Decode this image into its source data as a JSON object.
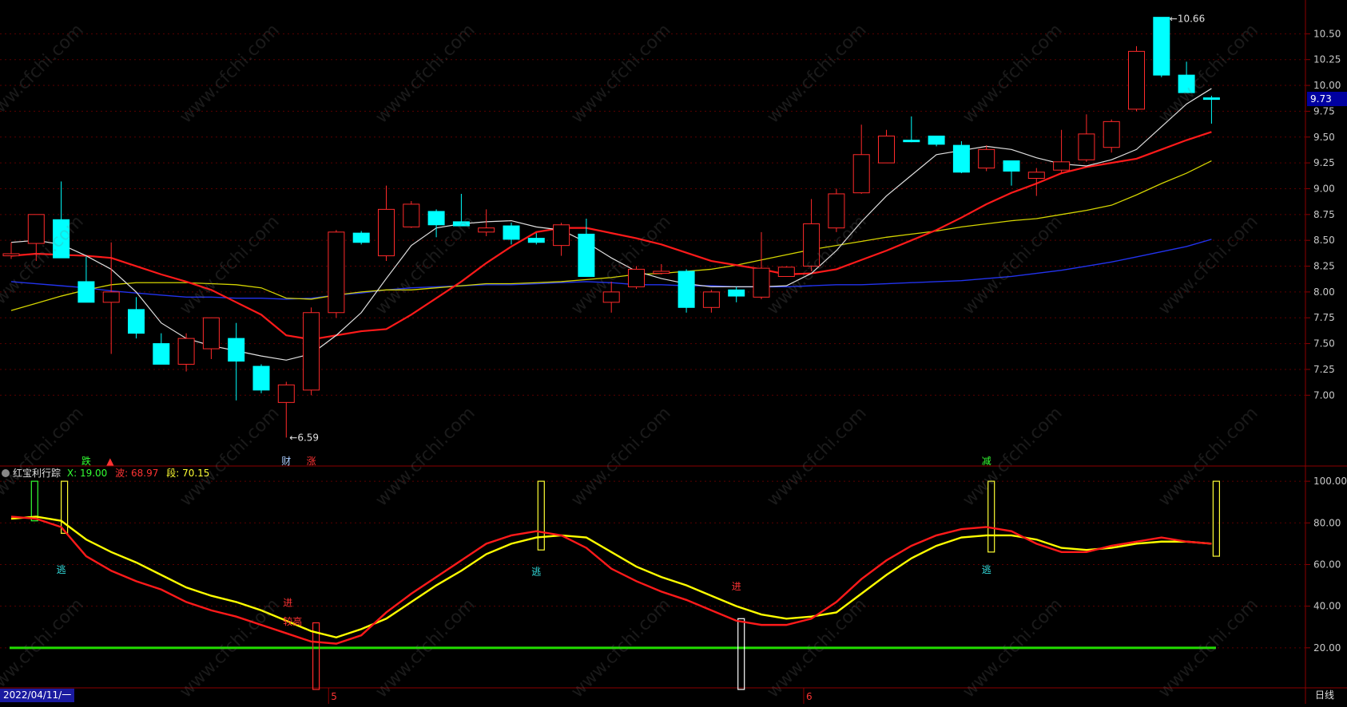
{
  "colors": {
    "up": "#ff2a2a",
    "down": "#00ffff",
    "ma5": "#e0e0e0",
    "ma10": "#ff1a1a",
    "ma20": "#d4d400",
    "ma60": "#2233ee",
    "k_line": "#ff1a1a",
    "d_line": "#ffff00",
    "base_line": "#22dd00",
    "frame": "#8b0000"
  },
  "price_axis": {
    "min": 6.5,
    "max": 10.75,
    "ticks": [
      "10.50",
      "10.25",
      "10.00",
      "9.75",
      "9.50",
      "9.25",
      "9.00",
      "8.75",
      "8.50",
      "8.25",
      "8.00",
      "7.75",
      "7.50",
      "7.25",
      "7.00"
    ]
  },
  "ind_axis": {
    "min": 0,
    "max": 110,
    "ticks": [
      "100.00",
      "80.00",
      "60.00",
      "40.00",
      "20.00"
    ]
  },
  "last_price_tag": "9.73",
  "high_label": "10.66",
  "low_label": "6.59",
  "indicator": {
    "name": "红宝利行踪",
    "x_label": "X:",
    "x_value": "19.00",
    "bo_label": "波:",
    "bo_value": "68.97",
    "duan_label": "段:",
    "duan_value": "70.15"
  },
  "event_labels": [
    {
      "text": "跌",
      "color": "#33ff33"
    },
    {
      "text": "▲",
      "color": "#ff3333"
    },
    {
      "text": "财",
      "color": "#aaccff"
    },
    {
      "text": "涨",
      "color": "#ff3333"
    },
    {
      "text": "减",
      "color": "#33ff33"
    }
  ],
  "signal_labels": [
    "逃",
    "进",
    "较高",
    "逃",
    "进",
    "逃"
  ],
  "date_start": "2022/04/11/一",
  "month_ticks": [
    "5",
    "6"
  ],
  "period_label": "日线",
  "watermark": "www.cfchi.com",
  "chart_data": {
    "type": "candlestick",
    "candles": [
      {
        "o": 8.35,
        "h": 8.48,
        "l": 8.32,
        "c": 8.37
      },
      {
        "o": 8.47,
        "h": 8.75,
        "l": 8.3,
        "c": 8.75
      },
      {
        "o": 8.7,
        "h": 9.07,
        "l": 8.33,
        "c": 8.33
      },
      {
        "o": 8.1,
        "h": 8.34,
        "l": 7.9,
        "c": 7.9
      },
      {
        "o": 7.9,
        "h": 8.48,
        "l": 7.4,
        "c": 8.0
      },
      {
        "o": 7.83,
        "h": 7.95,
        "l": 7.55,
        "c": 7.6
      },
      {
        "o": 7.5,
        "h": 7.6,
        "l": 7.3,
        "c": 7.3
      },
      {
        "o": 7.3,
        "h": 7.6,
        "l": 7.23,
        "c": 7.55
      },
      {
        "o": 7.45,
        "h": 7.7,
        "l": 7.35,
        "c": 7.75
      },
      {
        "o": 7.55,
        "h": 7.7,
        "l": 6.95,
        "c": 7.33
      },
      {
        "o": 7.28,
        "h": 7.3,
        "l": 7.02,
        "c": 7.05
      },
      {
        "o": 6.93,
        "h": 7.13,
        "l": 6.59,
        "c": 7.1
      },
      {
        "o": 7.05,
        "h": 7.85,
        "l": 7.0,
        "c": 7.8
      },
      {
        "o": 7.8,
        "h": 8.6,
        "l": 7.75,
        "c": 8.58
      },
      {
        "o": 8.57,
        "h": 8.59,
        "l": 8.46,
        "c": 8.48
      },
      {
        "o": 8.35,
        "h": 9.03,
        "l": 8.3,
        "c": 8.8
      },
      {
        "o": 8.63,
        "h": 8.88,
        "l": 8.62,
        "c": 8.85
      },
      {
        "o": 8.78,
        "h": 8.8,
        "l": 8.53,
        "c": 8.65
      },
      {
        "o": 8.68,
        "h": 8.95,
        "l": 8.64,
        "c": 8.64
      },
      {
        "o": 8.58,
        "h": 8.8,
        "l": 8.54,
        "c": 8.62
      },
      {
        "o": 8.64,
        "h": 8.67,
        "l": 8.46,
        "c": 8.51
      },
      {
        "o": 8.52,
        "h": 8.57,
        "l": 8.46,
        "c": 8.48
      },
      {
        "o": 8.45,
        "h": 8.67,
        "l": 8.35,
        "c": 8.65
      },
      {
        "o": 8.56,
        "h": 8.71,
        "l": 8.15,
        "c": 8.15
      },
      {
        "o": 7.9,
        "h": 8.1,
        "l": 7.8,
        "c": 8.0
      },
      {
        "o": 8.05,
        "h": 8.25,
        "l": 8.03,
        "c": 8.22
      },
      {
        "o": 8.18,
        "h": 8.27,
        "l": 8.17,
        "c": 8.2
      },
      {
        "o": 8.2,
        "h": 8.22,
        "l": 7.8,
        "c": 7.85
      },
      {
        "o": 7.85,
        "h": 8.02,
        "l": 7.8,
        "c": 8.0
      },
      {
        "o": 8.02,
        "h": 8.05,
        "l": 7.9,
        "c": 7.96
      },
      {
        "o": 7.95,
        "h": 8.58,
        "l": 7.93,
        "c": 8.23
      },
      {
        "o": 8.15,
        "h": 8.25,
        "l": 8.15,
        "c": 8.24
      },
      {
        "o": 8.25,
        "h": 8.9,
        "l": 8.2,
        "c": 8.66
      },
      {
        "o": 8.62,
        "h": 9.0,
        "l": 8.58,
        "c": 8.95
      },
      {
        "o": 8.96,
        "h": 9.62,
        "l": 8.95,
        "c": 9.33
      },
      {
        "o": 9.25,
        "h": 9.57,
        "l": 9.25,
        "c": 9.51
      },
      {
        "o": 9.47,
        "h": 9.7,
        "l": 9.45,
        "c": 9.46
      },
      {
        "o": 9.51,
        "h": 9.51,
        "l": 9.41,
        "c": 9.43
      },
      {
        "o": 9.42,
        "h": 9.46,
        "l": 9.15,
        "c": 9.16
      },
      {
        "o": 9.2,
        "h": 9.42,
        "l": 9.17,
        "c": 9.38
      },
      {
        "o": 9.27,
        "h": 9.27,
        "l": 9.03,
        "c": 9.17
      },
      {
        "o": 9.1,
        "h": 9.2,
        "l": 8.93,
        "c": 9.16
      },
      {
        "o": 9.18,
        "h": 9.57,
        "l": 9.16,
        "c": 9.26
      },
      {
        "o": 9.28,
        "h": 9.72,
        "l": 9.26,
        "c": 9.53
      },
      {
        "o": 9.4,
        "h": 9.67,
        "l": 9.35,
        "c": 9.65
      },
      {
        "o": 9.77,
        "h": 10.38,
        "l": 9.75,
        "c": 10.33
      },
      {
        "o": 10.66,
        "h": 10.66,
        "l": 10.08,
        "c": 10.1
      },
      {
        "o": 10.1,
        "h": 10.23,
        "l": 9.93,
        "c": 9.93
      },
      {
        "o": 9.88,
        "h": 9.9,
        "l": 9.63,
        "c": 9.87
      }
    ],
    "ma5": [
      8.48,
      8.5,
      8.46,
      8.35,
      8.22,
      8.0,
      7.7,
      7.55,
      7.48,
      7.43,
      7.38,
      7.34,
      7.4,
      7.58,
      7.8,
      8.13,
      8.45,
      8.62,
      8.66,
      8.68,
      8.69,
      8.63,
      8.6,
      8.48,
      8.33,
      8.2,
      8.13,
      8.08,
      8.05,
      8.05,
      8.05,
      8.06,
      8.18,
      8.4,
      8.68,
      8.93,
      9.13,
      9.33,
      9.37,
      9.41,
      9.38,
      9.3,
      9.24,
      9.22,
      9.28,
      9.38,
      9.6,
      9.82,
      9.97
    ],
    "ma10": [
      8.35,
      8.37,
      8.36,
      8.35,
      8.33,
      8.25,
      8.17,
      8.1,
      8.02,
      7.9,
      7.78,
      7.58,
      7.54,
      7.58,
      7.62,
      7.64,
      7.78,
      7.94,
      8.1,
      8.28,
      8.44,
      8.58,
      8.62,
      8.62,
      8.57,
      8.52,
      8.46,
      8.38,
      8.3,
      8.26,
      8.22,
      8.17,
      8.18,
      8.22,
      8.31,
      8.4,
      8.5,
      8.6,
      8.72,
      8.85,
      8.96,
      9.05,
      9.15,
      9.21,
      9.25,
      9.29,
      9.38,
      9.47,
      9.55
    ],
    "ma20": [
      7.82,
      7.89,
      7.96,
      8.02,
      8.07,
      8.09,
      8.09,
      8.09,
      8.08,
      8.07,
      8.04,
      7.94,
      7.93,
      7.97,
      8.0,
      8.02,
      8.02,
      8.04,
      8.06,
      8.08,
      8.08,
      8.09,
      8.1,
      8.12,
      8.14,
      8.17,
      8.18,
      8.2,
      8.22,
      8.26,
      8.31,
      8.36,
      8.41,
      8.45,
      8.49,
      8.53,
      8.56,
      8.59,
      8.63,
      8.66,
      8.69,
      8.71,
      8.75,
      8.79,
      8.84,
      8.94,
      9.05,
      9.15,
      9.27
    ],
    "ma60": [
      8.1,
      8.08,
      8.06,
      8.04,
      8.01,
      7.99,
      7.97,
      7.95,
      7.95,
      7.94,
      7.94,
      7.93,
      7.94,
      7.97,
      7.99,
      8.02,
      8.04,
      8.05,
      8.06,
      8.07,
      8.07,
      8.08,
      8.09,
      8.1,
      8.09,
      8.07,
      8.07,
      8.06,
      8.06,
      8.05,
      8.05,
      8.05,
      8.06,
      8.07,
      8.07,
      8.08,
      8.09,
      8.1,
      8.11,
      8.13,
      8.15,
      8.18,
      8.21,
      8.25,
      8.29,
      8.34,
      8.39,
      8.44,
      8.51
    ],
    "k": [
      83,
      82,
      78,
      64,
      57,
      52,
      48,
      42,
      38,
      35,
      31,
      27,
      23,
      22,
      26,
      37,
      46,
      54,
      62,
      70,
      74,
      76,
      74,
      68,
      58,
      52,
      47,
      43,
      38,
      33,
      31,
      31,
      34,
      42,
      53,
      62,
      69,
      74,
      77,
      78,
      76,
      70,
      66,
      66,
      69,
      71,
      73,
      71,
      70
    ],
    "d": [
      82,
      83,
      81,
      72,
      66,
      61,
      55,
      49,
      45,
      42,
      38,
      33,
      28,
      25,
      29,
      34,
      42,
      50,
      57,
      65,
      70,
      73,
      74,
      73,
      66,
      59,
      54,
      50,
      45,
      40,
      36,
      34,
      35,
      37,
      46,
      55,
      63,
      69,
      73,
      74,
      74,
      72,
      68,
      67,
      68,
      70,
      71,
      71,
      70
    ],
    "base": 20
  }
}
